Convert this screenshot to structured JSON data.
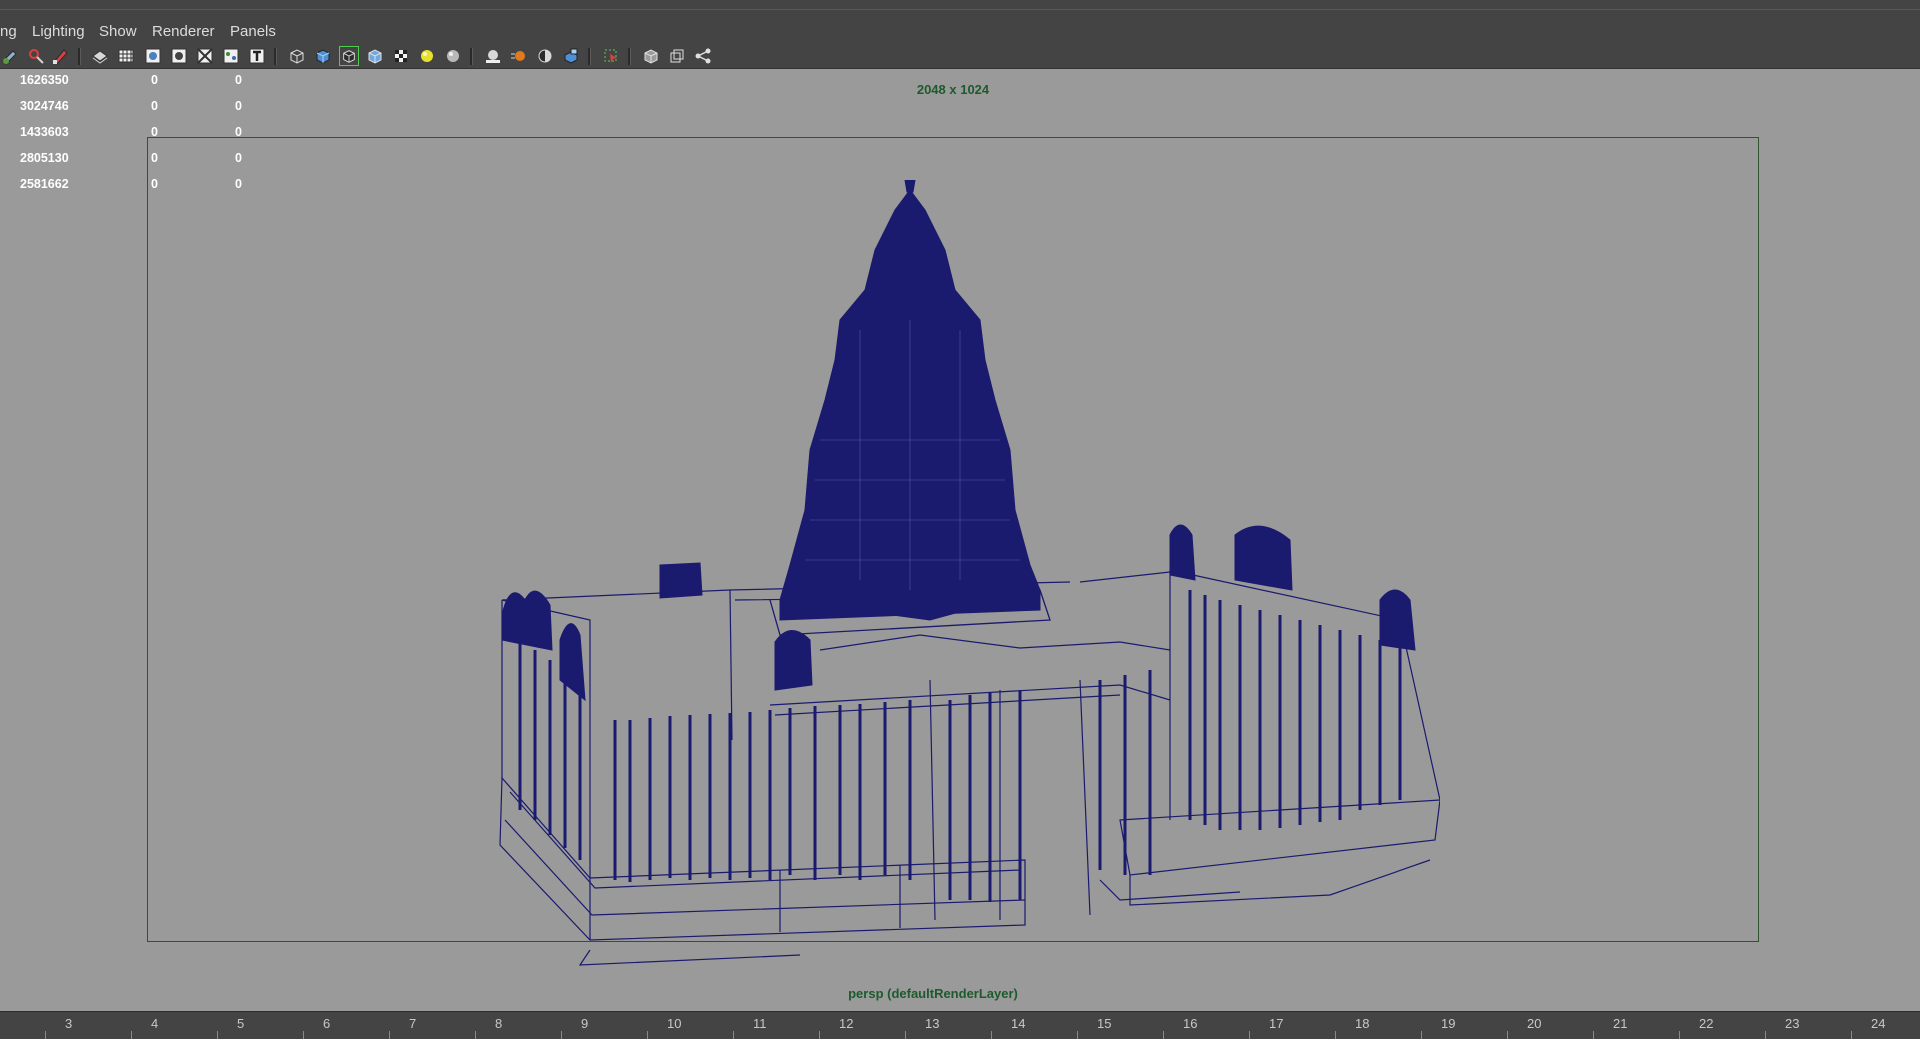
{
  "menubar": {
    "items": [
      {
        "label": "ng"
      },
      {
        "label": "Lighting"
      },
      {
        "label": "Show"
      },
      {
        "label": "Renderer"
      },
      {
        "label": "Panels"
      }
    ]
  },
  "toolbar": {
    "icons": [
      "select-camera-icon",
      "camera-attributes-icon",
      "bookmark-icon",
      "image-plane-icon",
      "grid-icon",
      "film-gate-icon",
      "resolution-gate-icon",
      "gate-mask-icon",
      "field-chart-icon",
      "safe-action-icon",
      "wireframe-icon",
      "smooth-shade-icon",
      "wireframe-on-shaded-icon",
      "default-material-icon",
      "textured-icon",
      "use-all-lights-icon",
      "shadows-icon",
      "screen-space-ao-icon",
      "motion-blur-icon",
      "anti-aliasing-icon",
      "depth-of-field-icon",
      "isolate-select-icon",
      "xray-icon",
      "xray-joints-icon",
      "xray-components-icon"
    ]
  },
  "hud": {
    "rows": [
      {
        "value": "1626350",
        "col2": "0",
        "col3": "0"
      },
      {
        "value": "3024746",
        "col2": "0",
        "col3": "0"
      },
      {
        "value": "1433603",
        "col2": "0",
        "col3": "0"
      },
      {
        "value": "2805130",
        "col2": "0",
        "col3": "0"
      },
      {
        "value": "2581662",
        "col2": "0",
        "col3": "0"
      }
    ]
  },
  "viewport": {
    "resolution": "2048 x 1024",
    "camera": "persp (defaultRenderLayer)",
    "wireframe_color": "#1a1a6e",
    "gate_color": "#2c5530",
    "background_color": "#9a9a9a"
  },
  "timeline": {
    "ticks": [
      "3",
      "4",
      "5",
      "6",
      "7",
      "8",
      "9",
      "10",
      "11",
      "12",
      "13",
      "14",
      "15",
      "16",
      "17",
      "18",
      "19",
      "20",
      "21",
      "22",
      "23",
      "24"
    ]
  }
}
